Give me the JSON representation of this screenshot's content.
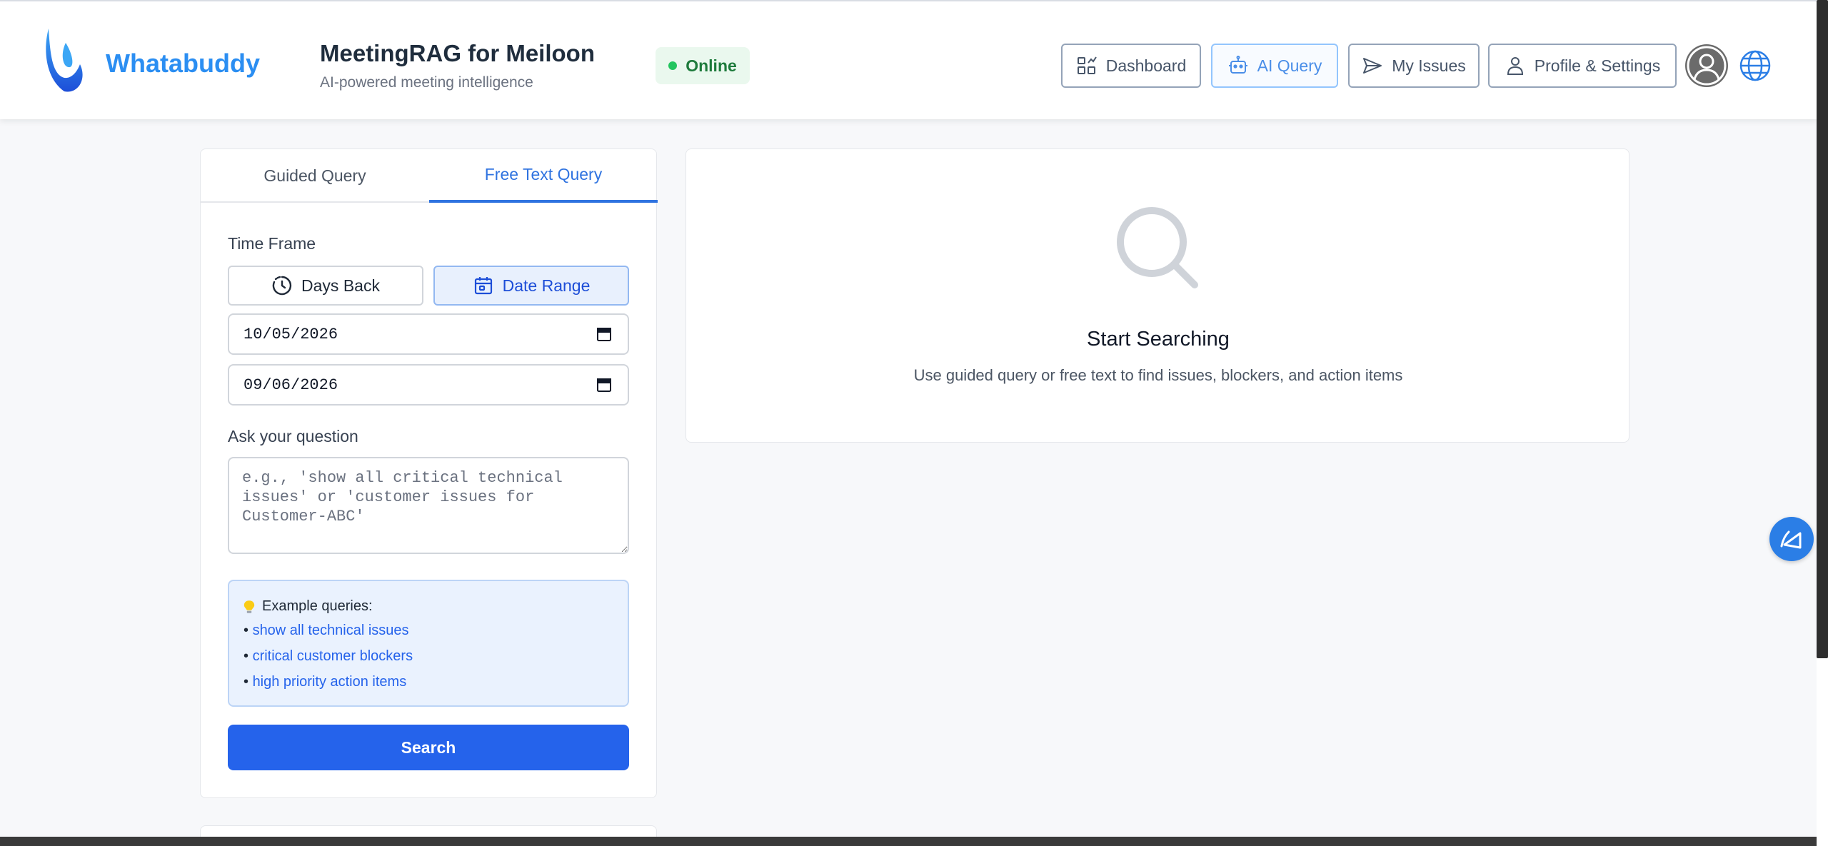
{
  "header": {
    "brand": "Whatabuddy",
    "title": "MeetingRAG for Meiloon",
    "subtitle": "AI-powered meeting intelligence",
    "status": "Online",
    "nav": {
      "dashboard": "Dashboard",
      "ai_query": "AI Query",
      "my_issues": "My Issues",
      "profile": "Profile & Settings"
    }
  },
  "query_panel": {
    "tabs": {
      "guided": "Guided Query",
      "free_text": "Free Text Query",
      "active": "Free Text Query"
    },
    "time_frame_label": "Time Frame",
    "time_frame_options": {
      "days_back": "Days Back",
      "date_range": "Date Range",
      "selected": "Date Range"
    },
    "start_date": "10/05/2026",
    "end_date": "09/06/2026",
    "question_label": "Ask your question",
    "question_placeholder": "e.g., 'show all critical technical issues' or 'customer issues for Customer-ABC'",
    "question_value": "",
    "examples_title": "Example queries:",
    "examples": [
      "show all technical issues",
      "critical customer blockers",
      "high priority action items"
    ],
    "search_button": "Search"
  },
  "results": {
    "empty_title": "Start Searching",
    "empty_subtitle": "Use guided query or free text to find issues, blockers, and action items"
  },
  "icons": {
    "logo": "whatabuddy-logo-icon",
    "dashboard": "dashboard-icon",
    "ai_query": "robot-icon",
    "my_issues": "send-icon",
    "profile": "user-icon",
    "avatar": "avatar-icon",
    "language": "globe-icon",
    "days_back": "history-icon",
    "date_range": "calendar-icon",
    "example_hint": "lightbulb-icon",
    "empty_state": "search-icon",
    "assistant": "assistant-fab-icon"
  },
  "colors": {
    "brand_blue": "#2b8ef2",
    "primary": "#2563eb",
    "online_green": "#22c55e",
    "active_tab": "#2f73e0"
  }
}
